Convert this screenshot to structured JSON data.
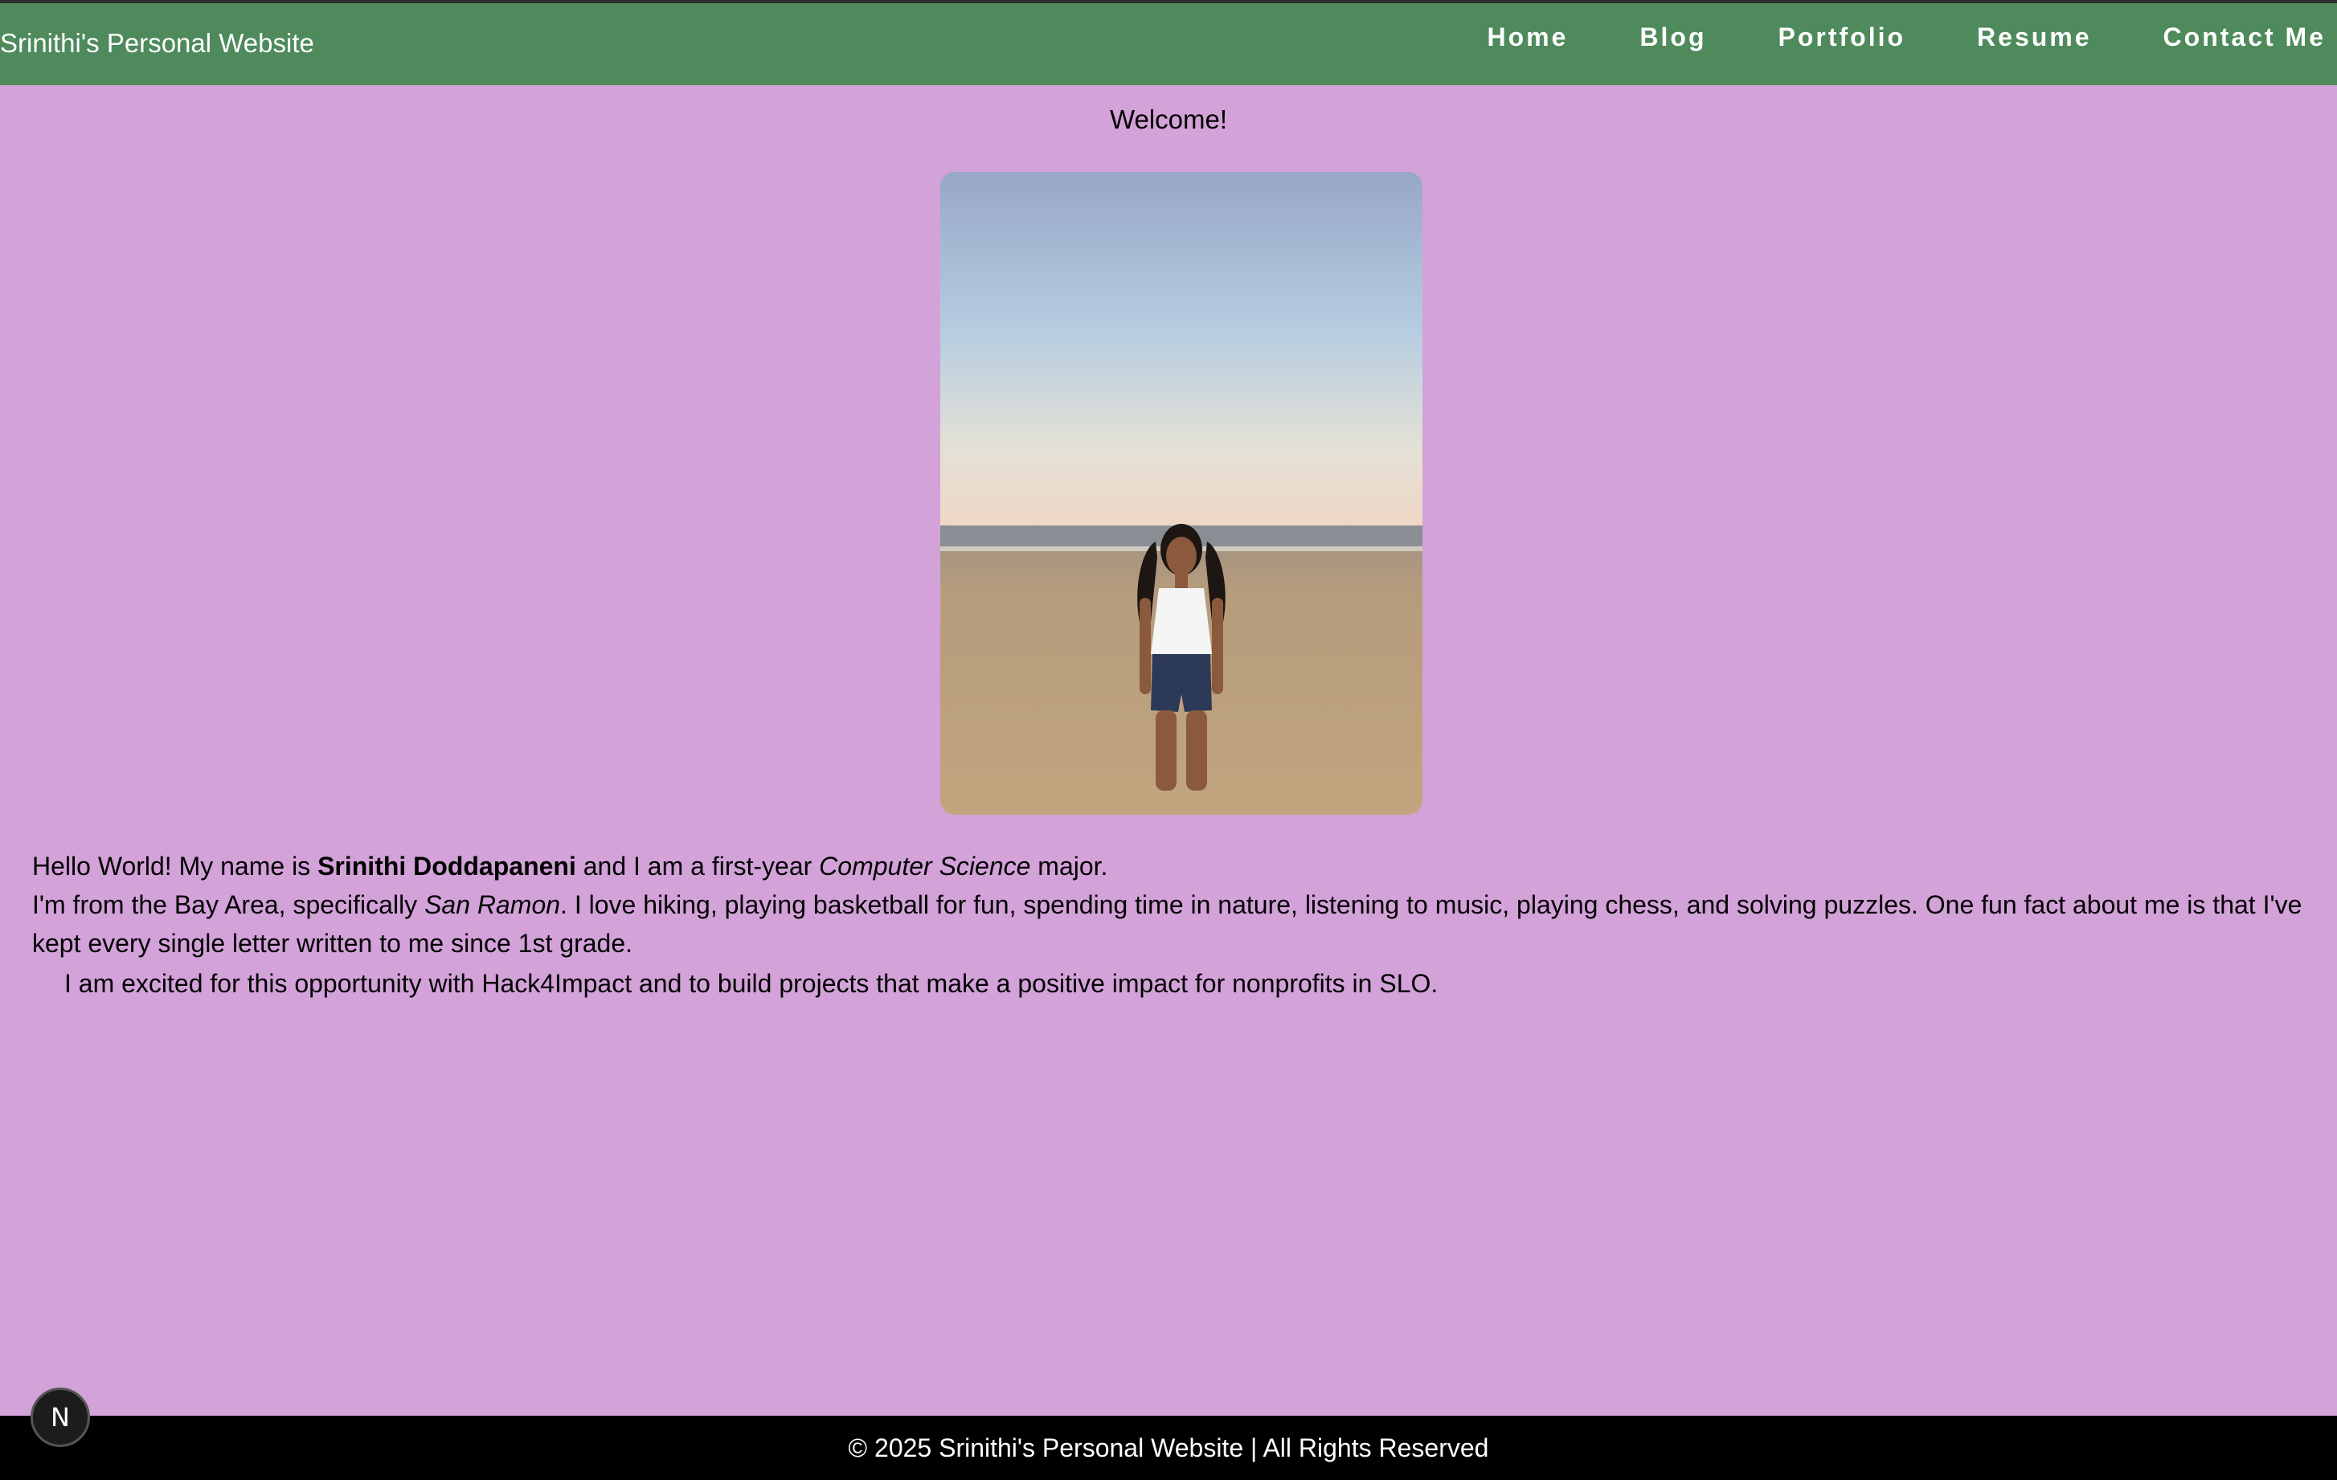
{
  "header": {
    "site_title": "Srinithi's Personal Website",
    "nav": [
      {
        "label": "Home"
      },
      {
        "label": "Blog"
      },
      {
        "label": "Portfolio"
      },
      {
        "label": "Resume"
      },
      {
        "label": "Contact Me"
      }
    ]
  },
  "main": {
    "welcome": "Welcome!",
    "bio": {
      "line1_pre": "Hello World! My name is ",
      "line1_name": "Srinithi Doddapaneni",
      "line1_mid": " and I am a first-year ",
      "line1_major": "Computer Science",
      "line1_post": " major.",
      "line2_pre": "I'm from the Bay Area, specifically ",
      "line2_city": "San Ramon",
      "line2_post": ". I love hiking, playing basketball for fun, spending time in nature, listening to music, playing chess, and solving puzzles. One fun fact about me is that I've kept every single letter written to me since 1st grade.",
      "line3": "I am excited for this opportunity with Hack4Impact and to build projects that make a positive impact for nonprofits in SLO."
    }
  },
  "footer": {
    "text": "© 2025 Srinithi's Personal Website | All Rights Reserved"
  },
  "badge": {
    "letter": "N"
  },
  "colors": {
    "background": "#d3a2d9",
    "header": "#4e8a5c",
    "footer": "#000000"
  }
}
